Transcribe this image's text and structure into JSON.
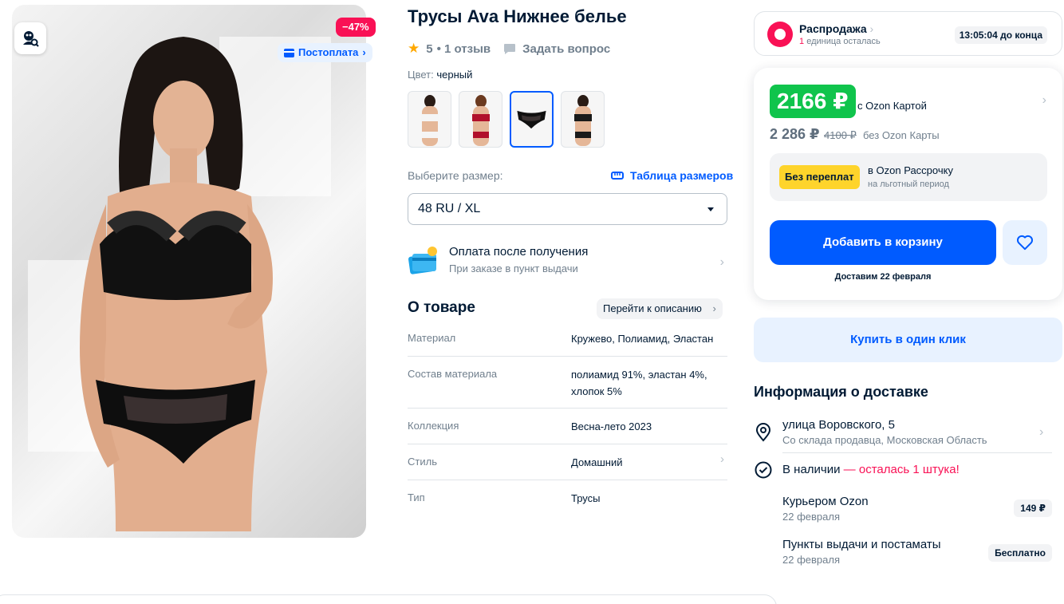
{
  "gallery": {
    "discount": "−47%",
    "postpay": "Постоплата"
  },
  "product": {
    "title": "Трусы Ava Нижнее белье",
    "rating": "5",
    "reviews": "• 1 отзыв",
    "ask": "Задать вопрос",
    "color_label": "Цвет:",
    "color_value": "черный",
    "size_label": "Выберите размер:",
    "size_table": "Таблица размеров",
    "size_selected": "48 RU / XL"
  },
  "payment_after": {
    "title": "Оплата после получения",
    "subtitle": "При заказе в пункт выдачи"
  },
  "about": {
    "title": "О товаре",
    "goto": "Перейти к описанию",
    "specs": [
      {
        "key": "Материал",
        "value": "Кружево, Полиамид, Эластан"
      },
      {
        "key": "Состав материала",
        "value": "полиамид 91%, эластан 4%, хлопок 5%"
      },
      {
        "key": "Коллекция",
        "value": "Весна-лето 2023"
      },
      {
        "key": "Стиль",
        "value": "Домашний"
      },
      {
        "key": "Тип",
        "value": "Трусы"
      }
    ]
  },
  "sale": {
    "title": "Распродажа",
    "left_count": "1",
    "left_text": "единица осталась",
    "timer": "13:05:04 до конца"
  },
  "price": {
    "ozon_price": "2166 ₽",
    "ozon_label": "с Ozon Картой",
    "regular": "2 286 ₽",
    "old": "4100 ₽",
    "without_label": "без Ozon Карты",
    "installment_badge": "Без переплат",
    "installment_title": "в Ozon Рассрочку",
    "installment_sub": "на льготный период",
    "add_to_cart": "Добавить в корзину",
    "deliver": "Доставим 22 февраля"
  },
  "one_click": "Купить в один клик",
  "delivery": {
    "title": "Информация о доставке",
    "address": "улица Воровского, 5",
    "warehouse": "Со склада продавца, Московская Область",
    "in_stock": "В наличии",
    "left": " — осталась 1 штука!",
    "options": [
      {
        "name": "Курьером Ozon",
        "date": "22 февраля",
        "cost": "149 ₽"
      },
      {
        "name": "Пункты выдачи и постаматы",
        "date": "22 февраля",
        "cost": "Бесплатно"
      }
    ]
  },
  "colors": {
    "accent": "#005bff",
    "sale": "#f91155",
    "ozon_price": "#10c44c",
    "installment": "#fed42b"
  }
}
